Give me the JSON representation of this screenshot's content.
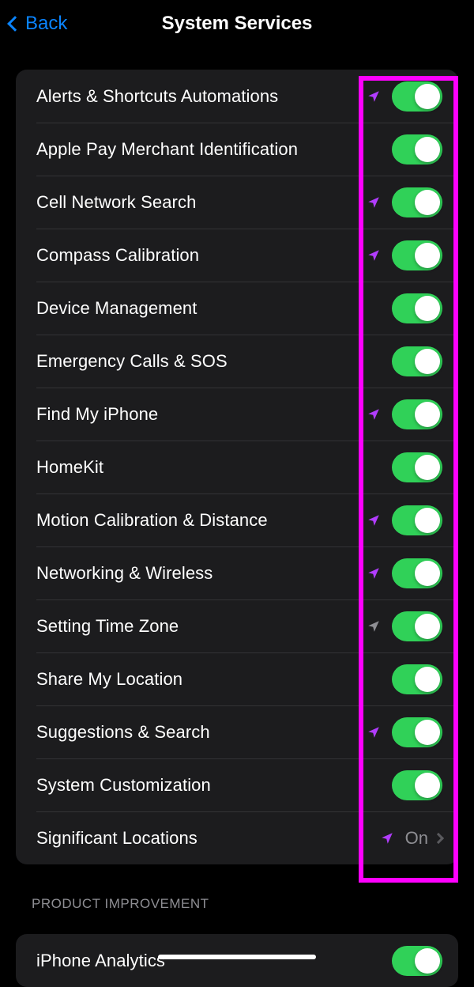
{
  "nav": {
    "back": "Back",
    "title": "System Services"
  },
  "rows": [
    {
      "label": "Alerts & Shortcuts Automations",
      "loc": "purple",
      "control": "toggle"
    },
    {
      "label": "Apple Pay Merchant Identification",
      "loc": "none",
      "control": "toggle"
    },
    {
      "label": "Cell Network Search",
      "loc": "purple",
      "control": "toggle"
    },
    {
      "label": "Compass Calibration",
      "loc": "purple",
      "control": "toggle"
    },
    {
      "label": "Device Management",
      "loc": "none",
      "control": "toggle"
    },
    {
      "label": "Emergency Calls & SOS",
      "loc": "none",
      "control": "toggle"
    },
    {
      "label": "Find My iPhone",
      "loc": "purple",
      "control": "toggle"
    },
    {
      "label": "HomeKit",
      "loc": "none",
      "control": "toggle"
    },
    {
      "label": "Motion Calibration & Distance",
      "loc": "purple",
      "control": "toggle"
    },
    {
      "label": "Networking & Wireless",
      "loc": "purple",
      "control": "toggle"
    },
    {
      "label": "Setting Time Zone",
      "loc": "gray",
      "control": "toggle"
    },
    {
      "label": "Share My Location",
      "loc": "none",
      "control": "toggle"
    },
    {
      "label": "Suggestions & Search",
      "loc": "purple",
      "control": "toggle"
    },
    {
      "label": "System Customization",
      "loc": "none",
      "control": "toggle"
    },
    {
      "label": "Significant Locations",
      "loc": "purple",
      "control": "link",
      "detail": "On"
    }
  ],
  "section2": {
    "header": "PRODUCT IMPROVEMENT",
    "rows": [
      {
        "label": "iPhone Analytics",
        "loc": "none",
        "control": "toggle"
      }
    ]
  }
}
